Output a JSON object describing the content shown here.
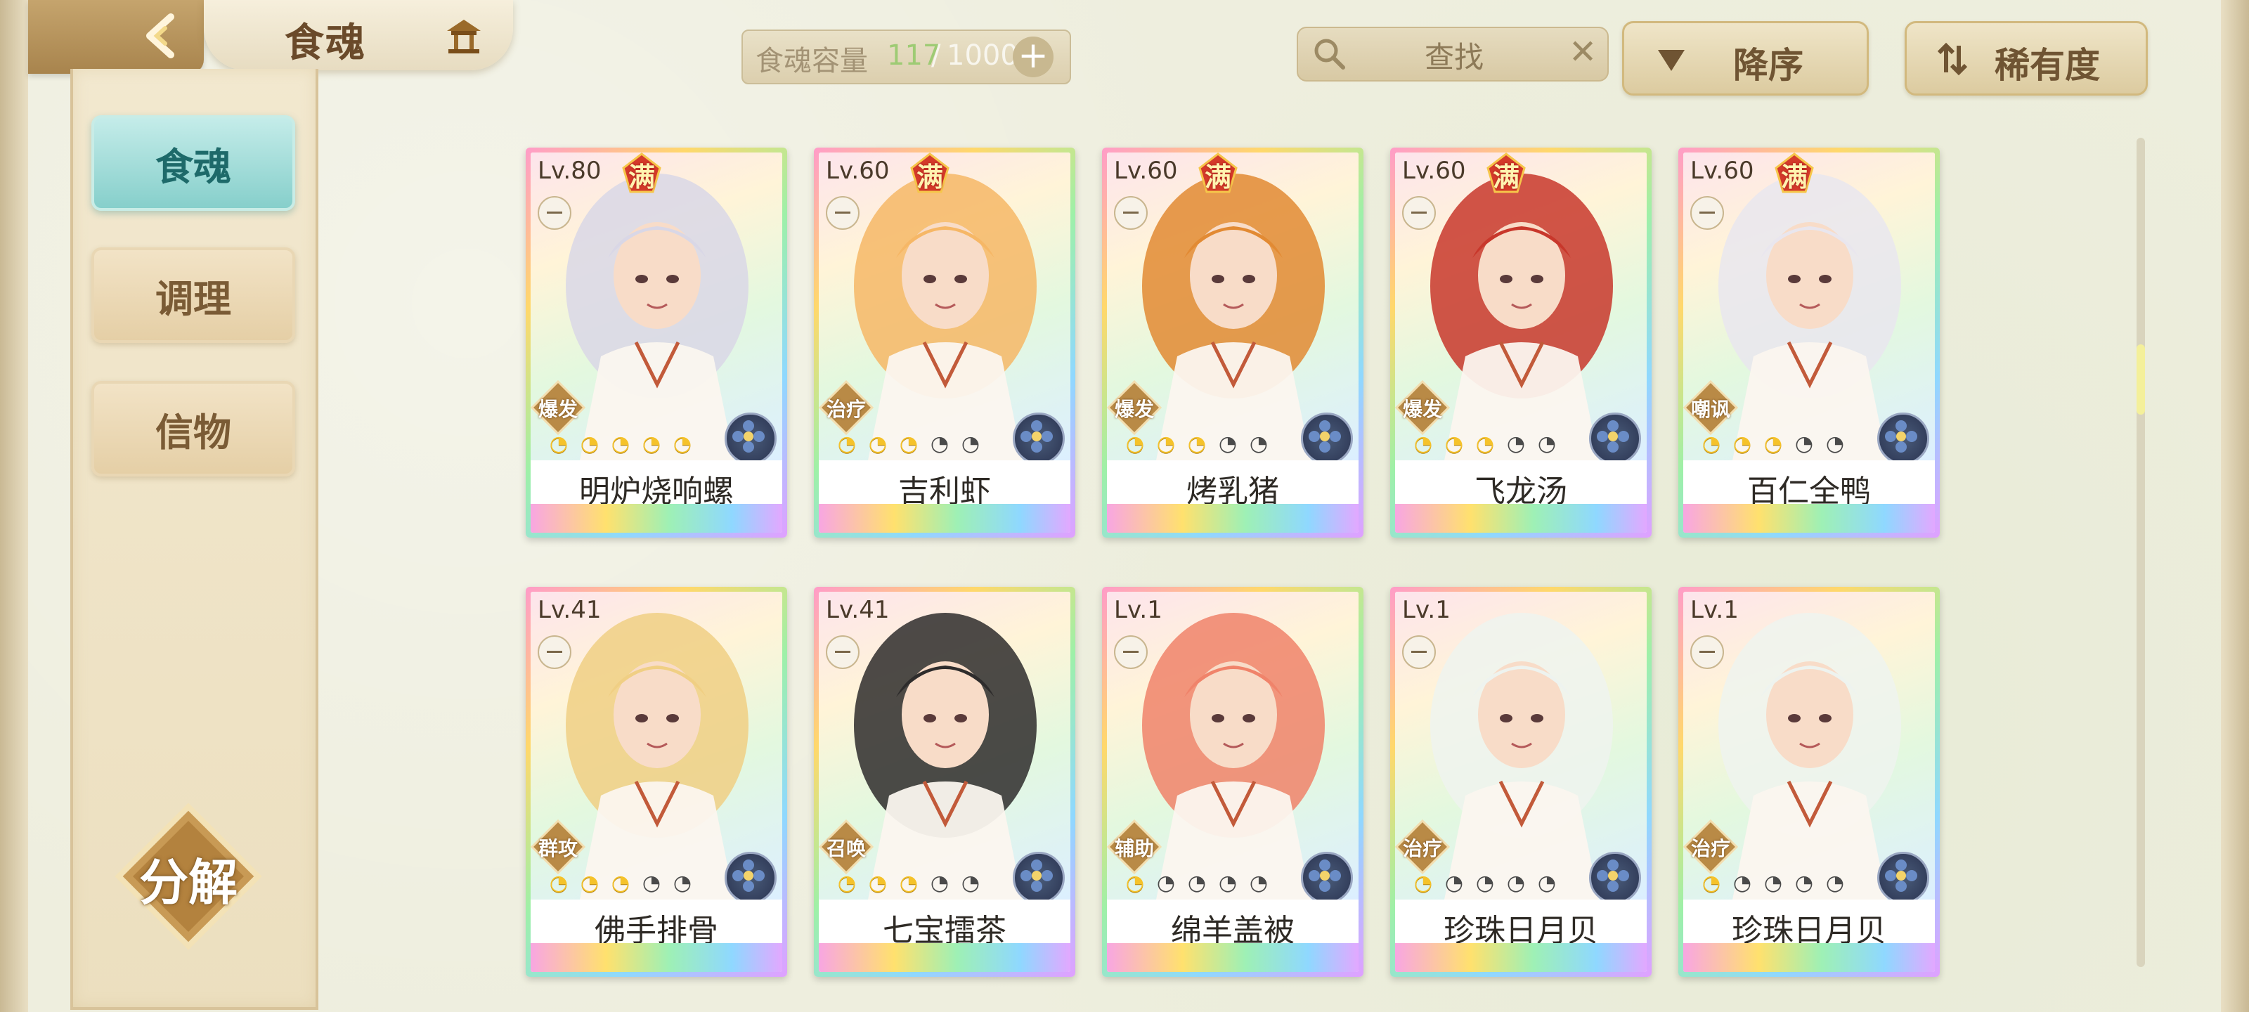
{
  "header": {
    "title": "食魂",
    "capacity_label": "食魂容量",
    "capacity_count": "117",
    "capacity_slash": "/",
    "capacity_max": "1000",
    "capacity_plus": "+",
    "search_label": "查找",
    "search_clear": "✕",
    "sort_order_label": "降序",
    "sort_key_label": "稀有度"
  },
  "sidebar": {
    "tabs": [
      {
        "label": "食魂",
        "active": true
      },
      {
        "label": "调理",
        "active": false
      },
      {
        "label": "信物",
        "active": false
      }
    ],
    "decompose_label": "分解"
  },
  "cards": [
    {
      "level": "Lv.80",
      "full": "满",
      "role": "爆发",
      "name": "明炉烧响螺",
      "stars": 5,
      "stars_on": 5,
      "hair": "#d9d7e6"
    },
    {
      "level": "Lv.60",
      "full": "满",
      "role": "治疗",
      "name": "吉利虾",
      "stars": 5,
      "stars_on": 3,
      "hair": "#f6b766"
    },
    {
      "level": "Lv.60",
      "full": "满",
      "role": "爆发",
      "name": "烤乳猪",
      "stars": 5,
      "stars_on": 3,
      "hair": "#e28a33"
    },
    {
      "level": "Lv.60",
      "full": "满",
      "role": "爆发",
      "name": "飞龙汤",
      "stars": 5,
      "stars_on": 3,
      "hair": "#c8372b"
    },
    {
      "level": "Lv.60",
      "full": "满",
      "role": "嘲讽",
      "name": "百仁全鸭",
      "stars": 5,
      "stars_on": 3,
      "hair": "#e9e6ee"
    },
    {
      "level": "Lv.41",
      "full": "",
      "role": "群攻",
      "name": "佛手排骨",
      "stars": 5,
      "stars_on": 3,
      "hair": "#f0cf84"
    },
    {
      "level": "Lv.41",
      "full": "",
      "role": "召唤",
      "name": "七宝擂茶",
      "stars": 5,
      "stars_on": 3,
      "hair": "#2e2c2c"
    },
    {
      "level": "Lv.1",
      "full": "",
      "role": "辅助",
      "name": "绵羊盖被",
      "stars": 5,
      "stars_on": 1,
      "hair": "#f0836a"
    },
    {
      "level": "Lv.1",
      "full": "",
      "role": "治疗",
      "name": "珍珠日月贝",
      "stars": 5,
      "stars_on": 1,
      "hair": "#eef3ef"
    },
    {
      "level": "Lv.1",
      "full": "",
      "role": "治疗",
      "name": "珍珠日月贝",
      "stars": 5,
      "stars_on": 1,
      "hair": "#eef3ef"
    }
  ],
  "colors": {
    "accent_teal": "#86cfcb",
    "gold": "#d2b97e",
    "capacity_count": "#9ecb74"
  },
  "icons": {
    "back": "back-arrow-icon",
    "home": "pavilion-icon",
    "search": "magnifier-icon",
    "sort_order": "triangle-down-icon",
    "sort_key": "sort-arrows-icon",
    "full": "full-level-badge-icon",
    "element": "flower-element-icon"
  }
}
